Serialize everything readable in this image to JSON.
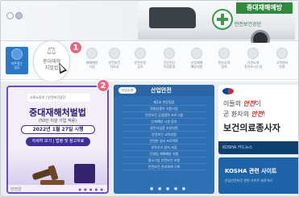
{
  "hero": {
    "van_text": "중대재해예방",
    "van_small": "안전보건공단"
  },
  "quick_menu": [
    {
      "label": "자주찾는\n업무"
    },
    {
      "label": "재해예방\n사업"
    },
    {
      "label": "안전보건\n자료실"
    },
    {
      "label": "안전인증\n검사"
    },
    {
      "label": "건강진단\n작업환경"
    },
    {
      "label": "산업재해\n예방지원"
    },
    {
      "label": "정보공개\n참여"
    },
    {
      "label": "기관소개\n찾아오시는길"
    },
    {
      "label": "고객센터\n민원"
    }
  ],
  "highlight": {
    "label": "중대재해\n처벌법",
    "number": "1"
  },
  "callouts": {
    "second": "2"
  },
  "card_law": {
    "orgs": "고용노동부 | 안전보건공단",
    "title": "중대재해처벌법",
    "subtitle": "(50인 이상 기업 적용)",
    "date": "2022년 1월 27일 시행",
    "guide": "자세히 보기 | 법령 및 참고자료",
    "tag": "안전은",
    "dots": "● ● ● ● ●"
  },
  "card_safety": {
    "pill": "사업소개",
    "title": "산업안전",
    "rows": [
      "제1호 현장점검",
      "위험성평가 지원사업",
      "안전보건 공생협력 프로그램",
      "산재예방 시설 융자",
      "클린사업장 조성지원",
      "안전보건 교육지원",
      "안전한 일터 프로젝트",
      "추락사고 방지 사업",
      "건설업 재해예방 지원",
      "중소기업 안전보건 지원",
      "안전보건 관리체계 구축"
    ],
    "dots": "● ● ● ● ●"
  },
  "card_health": {
    "line1_pre": "이들의 ",
    "line1_em": "안전",
    "line1_post": "이",
    "line2_pre": "곧 환자의 ",
    "line2_em": "안전",
    "line2_post": "!",
    "line3": "보건의료종사자",
    "footer": "KOSHA 카드뉴스"
  },
  "card_sites": {
    "title": "KOSHA 관련 사이트",
    "subtitle": "산업안전보건 관련 사이트 바로가기"
  }
}
